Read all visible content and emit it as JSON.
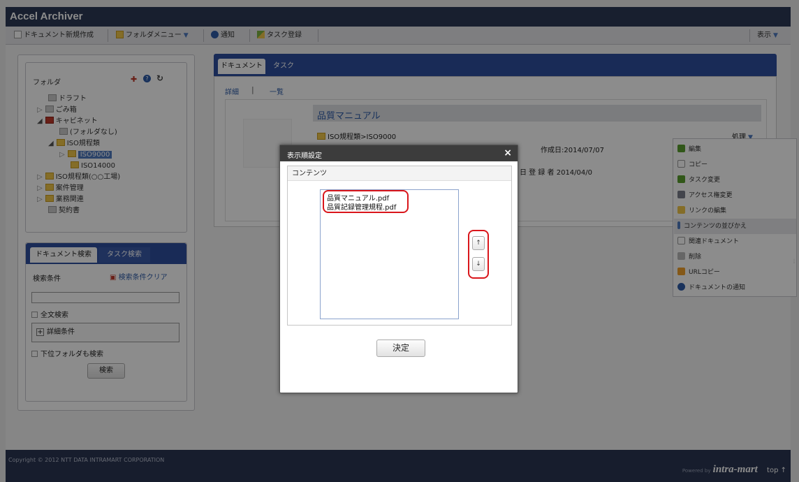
{
  "app": {
    "title": "Accel Archiver"
  },
  "toolbar": {
    "new_doc": "ドキュメント新規作成",
    "folder_menu": "フォルダメニュー",
    "notify": "通知",
    "task_register": "タスク登録",
    "display": "表示"
  },
  "folder_panel": {
    "title": "フォルダ",
    "items": [
      {
        "label": "ドラフト"
      },
      {
        "label": "ごみ箱"
      },
      {
        "label": "キャビネット"
      },
      {
        "label": "(フォルダなし)"
      },
      {
        "label": "ISO規程類"
      },
      {
        "label": "ISO9000"
      },
      {
        "label": "ISO14000"
      },
      {
        "label": "ISO規程類(○○工場)"
      },
      {
        "label": "案件管理"
      },
      {
        "label": "業務関連"
      },
      {
        "label": "契約書"
      }
    ]
  },
  "search_panel": {
    "tab_doc": "ドキュメント検索",
    "tab_task": "タスク検索",
    "conditions_label": "検索条件",
    "clear_label": "検索条件クリア",
    "fulltext_label": "全文検索",
    "detail_label": "詳細条件",
    "subfolder_label": "下位フォルダも検索",
    "search_button": "検索"
  },
  "doc_panel": {
    "tab_doc": "ドキュメント",
    "tab_task": "タスク",
    "view_detail": "詳細",
    "view_list": "一覧",
    "doc_title": "品質マニュアル",
    "path": "ISO規程類>ISO9000",
    "process_label": "処理",
    "created": "作成日:2014/07/07",
    "registered": "日 登 録 者 2014/04/0"
  },
  "context_menu": {
    "items": [
      {
        "label": "編集",
        "icon": "pencil-icon"
      },
      {
        "label": "コピー",
        "icon": "copy-icon"
      },
      {
        "label": "タスク変更",
        "icon": "pencil-icon"
      },
      {
        "label": "アクセス権変更",
        "icon": "users-icon"
      },
      {
        "label": "リンクの編集",
        "icon": "link-icon"
      },
      {
        "label": "コンテンツの並びかえ",
        "icon": "sort-icon"
      },
      {
        "label": "関連ドキュメント",
        "icon": "doc-icon"
      },
      {
        "label": "削除",
        "icon": "trash-icon"
      },
      {
        "label": "URLコピー",
        "icon": "url-icon"
      },
      {
        "label": "ドキュメントの通知",
        "icon": "info-icon"
      }
    ]
  },
  "dialog": {
    "title": "表示順設定",
    "close": "×",
    "section_label": "コンテンツ",
    "items": [
      "品質マニュアル.pdf",
      "品質記録管理規程.pdf"
    ],
    "up_label": "↑",
    "down_label": "↓",
    "decide_button": "決定"
  },
  "footer": {
    "copyright": "Copyright © 2012 NTT DATA INTRAMART CORPORATION",
    "powered_by": "Powered by",
    "logo_text": "intra-mart",
    "top_link": "top ↑"
  },
  "colors": {
    "header": "#2d3a56",
    "tab_active": "#2e4f9e",
    "highlight": "#d9161b"
  }
}
